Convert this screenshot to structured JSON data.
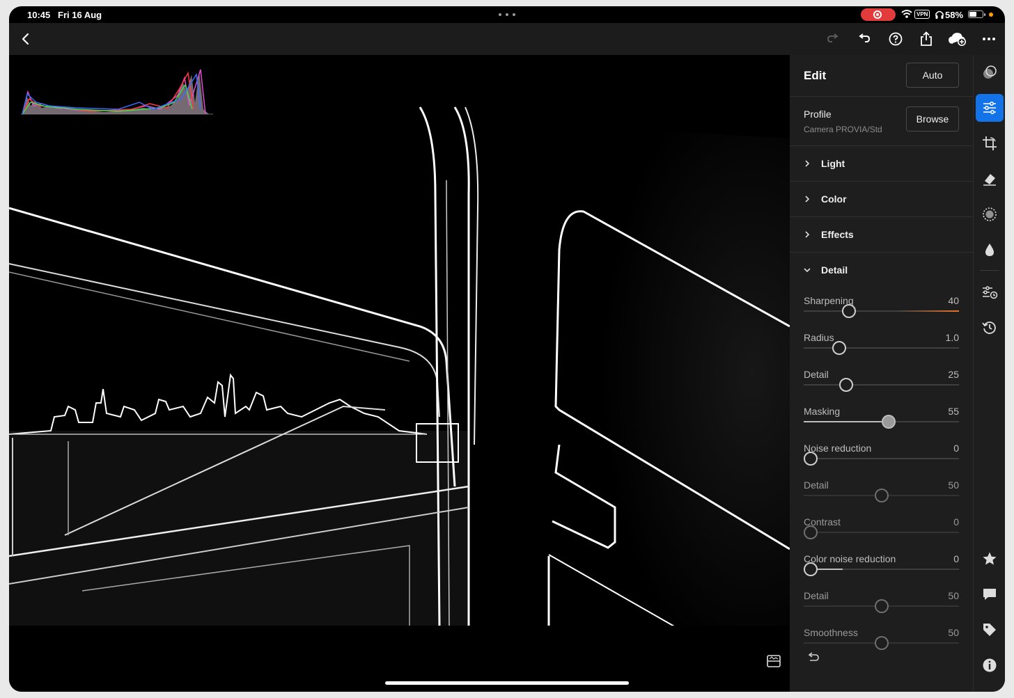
{
  "status_bar": {
    "time": "10:45",
    "date": "Fri 16 Aug",
    "vpn": "VPN",
    "battery_text": "58%",
    "battery_level": 0.58,
    "recording_color": "#e23b3b"
  },
  "toolbar": {
    "icons": [
      "back-icon",
      "redo-icon",
      "undo-icon",
      "help-icon",
      "share-icon",
      "cloud-add-icon",
      "more-icon"
    ]
  },
  "panel": {
    "title": "Edit",
    "auto_label": "Auto",
    "profile": {
      "label": "Profile",
      "value": "Camera PROVIA/Std",
      "browse_label": "Browse"
    },
    "sections": {
      "light": "Light",
      "color": "Color",
      "effects": "Effects",
      "detail": "Detail"
    },
    "sliders": [
      {
        "label": "Sharpening",
        "value": "40",
        "position": 0.29
      },
      {
        "label": "Radius",
        "value": "1.0",
        "position": 0.23
      },
      {
        "label": "Detail",
        "value": "25",
        "position": 0.275
      },
      {
        "label": "Masking",
        "value": "55",
        "position": 0.545
      },
      {
        "label": "Noise reduction",
        "value": "0",
        "position": 0.045
      },
      {
        "label": "Detail",
        "value": "50",
        "position": 0.5
      },
      {
        "label": "Contrast",
        "value": "0",
        "position": 0.045
      },
      {
        "label": "Color noise reduction",
        "value": "0",
        "position": 0.045
      },
      {
        "label": "Detail",
        "value": "50",
        "position": 0.5
      },
      {
        "label": "Smoothness",
        "value": "50",
        "position": 0.5
      }
    ]
  },
  "rail": {
    "icons": [
      "presets-icon",
      "edit-sliders-icon",
      "crop-icon",
      "healing-icon",
      "masking-icon",
      "blur-icon",
      "versions-icon",
      "history-icon",
      "rating-star-icon",
      "comment-icon",
      "tag-icon",
      "info-icon"
    ],
    "accent_color": "#1473e6"
  },
  "colors": {
    "sharpen_accent": "#e8752a",
    "panel_bg": "#1e1e1e"
  }
}
